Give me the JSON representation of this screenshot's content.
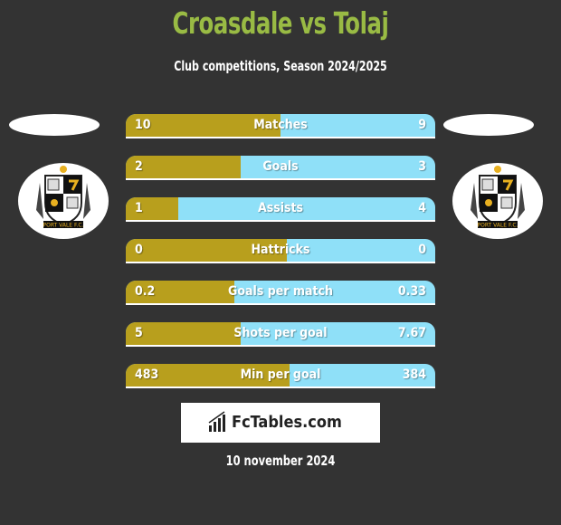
{
  "header": {
    "title": "Croasdale vs Tolaj",
    "subtitle": "Club competitions, Season 2024/2025"
  },
  "teams": {
    "left": {
      "player": "Croasdale",
      "club_badge_text": "PORT VALE F.C."
    },
    "right": {
      "player": "Tolaj",
      "club_badge_text": "PORT VALE F.C."
    }
  },
  "colors": {
    "title": "#99bb44",
    "left_bar": "#b89f1d",
    "right_bar": "#8fe0f8",
    "background": "#333333"
  },
  "chart_data": {
    "type": "bar",
    "orientation": "horizontal-comparison",
    "title": "Croasdale vs Tolaj",
    "subtitle": "Club competitions, Season 2024/2025",
    "categories": [
      "Matches",
      "Goals",
      "Assists",
      "Hattricks",
      "Goals per match",
      "Shots per goal",
      "Min per goal"
    ],
    "series": [
      {
        "name": "Croasdale",
        "values": [
          10,
          2,
          1,
          0,
          0.2,
          5,
          483
        ],
        "labels": [
          "10",
          "2",
          "1",
          "0",
          "0.2",
          "5",
          "483"
        ]
      },
      {
        "name": "Tolaj",
        "values": [
          9,
          3,
          4,
          0,
          0.33,
          7.67,
          384
        ],
        "labels": [
          "9",
          "3",
          "4",
          "0",
          "0.33",
          "7.67",
          "384"
        ]
      }
    ],
    "left_share": [
      0.5,
      0.37,
      0.17,
      0.52,
      0.35,
      0.37,
      0.53
    ]
  },
  "footer": {
    "brand": "FcTables.com",
    "date": "10 november 2024"
  }
}
